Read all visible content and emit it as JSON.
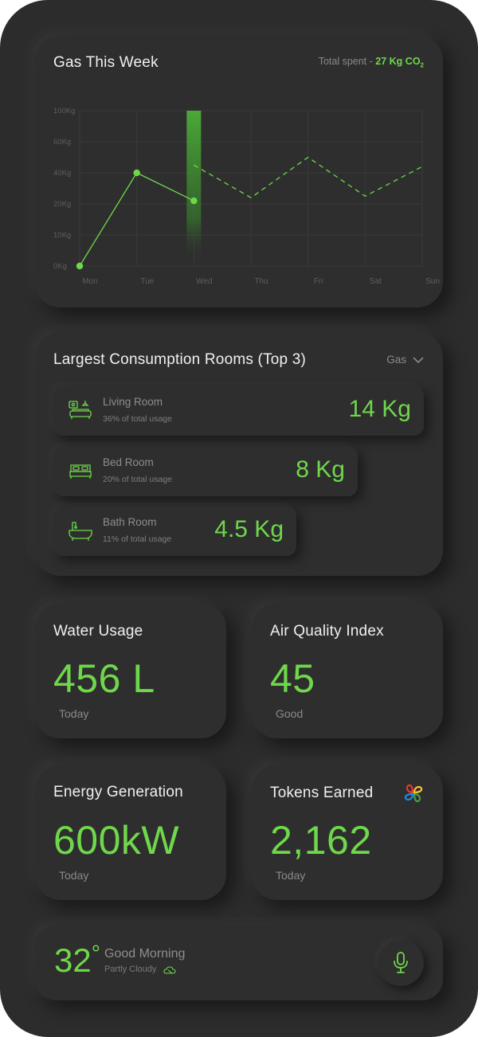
{
  "gas": {
    "title": "Gas This Week",
    "total_prefix": "Total spent - ",
    "total_value": "27 Kg CO",
    "total_sub": "2"
  },
  "chart_data": {
    "type": "line",
    "categories": [
      "Mon",
      "Tue",
      "Wed",
      "Thu",
      "Fri",
      "Sat",
      "Sun"
    ],
    "y_ticks": [
      "100Kg",
      "60Kg",
      "40Kg",
      "20Kg",
      "10Kg",
      "0Kg"
    ],
    "ylim": [
      0,
      100
    ],
    "series": [
      {
        "values": [
          0,
          40,
          22,
          null,
          null,
          null,
          null
        ]
      },
      {
        "values": [
          null,
          null,
          45,
          24,
          50,
          25,
          44
        ]
      }
    ],
    "highlight_category": "Wed",
    "grid": true,
    "line_color": "#6fd84a"
  },
  "rooms": {
    "title": "Largest Consumption Rooms (Top 3)",
    "filter_label": "Gas",
    "items": [
      {
        "name": "Living Room",
        "pct": "36% of total usage",
        "value": "14 Kg",
        "icon": "living-room-icon"
      },
      {
        "name": "Bed Room",
        "pct": "20% of total usage",
        "value": "8 Kg",
        "icon": "bed-icon"
      },
      {
        "name": "Bath Room",
        "pct": "11% of total usage",
        "value": "4.5 Kg",
        "icon": "bathtub-icon"
      }
    ]
  },
  "water": {
    "title": "Water Usage",
    "value": "456 L",
    "sub": "Today"
  },
  "air": {
    "title": "Air Quality Index",
    "value": "45",
    "sub": "Good"
  },
  "energy": {
    "title": "Energy Generation",
    "value": "600kW",
    "sub": "Today"
  },
  "tokens": {
    "title": "Tokens Earned",
    "value": "2,162",
    "sub": "Today",
    "icon": "token-flower-icon"
  },
  "weather": {
    "temp": "32",
    "degree": "°",
    "greeting": "Good Morning",
    "condition": "Partly Cloudy",
    "mic_icon": "microphone-icon"
  },
  "colors": {
    "accent": "#6fd84a",
    "background": "#2c2c2c",
    "card": "#2e2e2e"
  }
}
